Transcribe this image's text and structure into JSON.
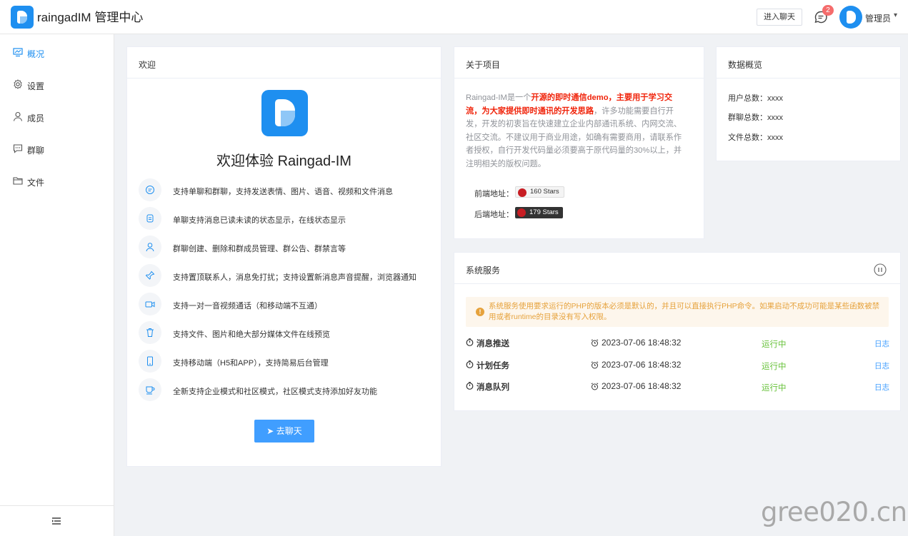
{
  "header": {
    "title": "raingadIM 管理中心",
    "enter_chat": "进入聊天",
    "badge_count": "2",
    "user_name": "管理员"
  },
  "sidebar": {
    "items": [
      {
        "label": "概况",
        "icon": "monitor-icon",
        "active": true
      },
      {
        "label": "设置",
        "icon": "gear-icon"
      },
      {
        "label": "成员",
        "icon": "user-icon"
      },
      {
        "label": "群聊",
        "icon": "chat-icon"
      },
      {
        "label": "文件",
        "icon": "folder-icon"
      }
    ],
    "footer_icon": "menu-collapse-icon"
  },
  "welcome": {
    "card_title": "欢迎",
    "heading": "欢迎体验 Raingad-IM",
    "features": [
      "支持单聊和群聊，支持发送表情、图片、语音、视频和文件消息",
      "单聊支持消息已读未读的状态显示，在线状态显示",
      "群聊创建、删除和群成员管理、群公告、群禁言等",
      "支持置顶联系人，消息免打扰；支持设置新消息声音提醒，浏览器通知",
      "支持一对一音视频通话（和移动端不互通）",
      "支持文件、图片和绝大部分媒体文件在线预览",
      "支持移动端（H5和APP），支持简易后台管理",
      "全新支持企业模式和社区模式，社区模式支持添加好友功能"
    ],
    "button": "去聊天"
  },
  "about": {
    "card_title": "关于项目",
    "text_prefix": "Raingad-IM是一个",
    "text_highlight": "开源的即时通信demo，主要用于学习交流，为大家提供即时通讯的开发思路",
    "text_suffix": "，许多功能需要自行开发，开发的初衷旨在快速建立企业内部通讯系统、内网交流、社区交流。不建议用于商业用途，如确有需要商用，请联系作者授权，自行开发代码量必须要高于原代码量的30%以上，并注明相关的版权问题。",
    "frontend_label": "前端地址：",
    "frontend_stars": "160 Stars",
    "backend_label": "后端地址：",
    "backend_stars": "179 Stars"
  },
  "overview": {
    "card_title": "数据概览",
    "users": "用户总数：xxxx",
    "groups": "群聊总数：xxxx",
    "files": "文件总数：xxxx"
  },
  "services": {
    "card_title": "系统服务",
    "alert": "系统服务使用要求运行的PHP的版本必须是默认的，并且可以直接执行PHP命令。如果启动不成功可能是某些函数被禁用或者runtime的目录没有写入权限。",
    "rows": [
      {
        "name": "消息推送",
        "time": "2023-07-06 18:48:32",
        "status": "运行中",
        "log": "日志"
      },
      {
        "name": "计划任务",
        "time": "2023-07-06 18:48:32",
        "status": "运行中",
        "log": "日志"
      },
      {
        "name": "消息队列",
        "time": "2023-07-06 18:48:32",
        "status": "运行中",
        "log": "日志"
      }
    ]
  },
  "watermark": "gree020.cn",
  "colors": {
    "primary": "#1e8ff0",
    "success": "#67c23a",
    "warning": "#e6a23c",
    "danger": "#f56c6c"
  }
}
